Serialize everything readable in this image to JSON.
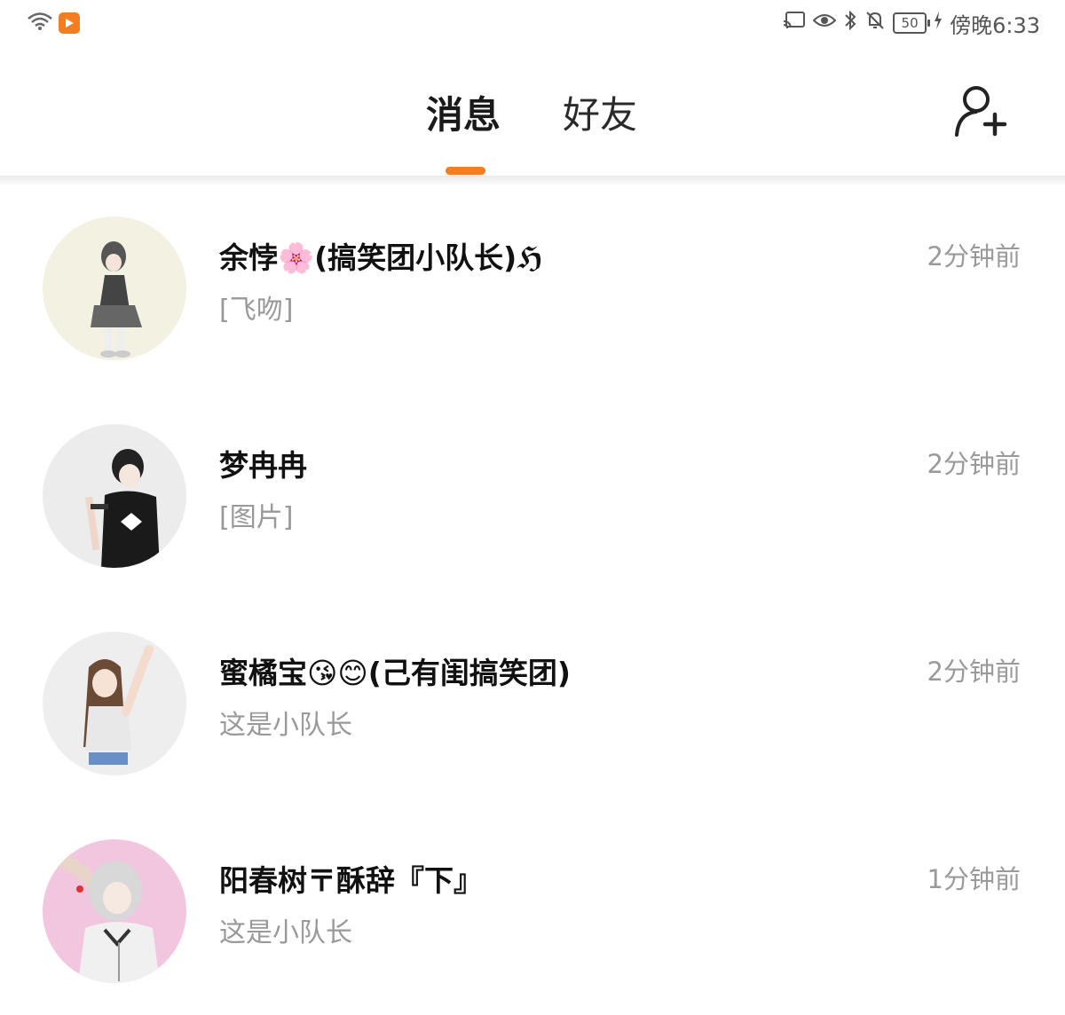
{
  "status_bar": {
    "time": "傍晚6:33",
    "battery": "50",
    "icons": [
      "wifi-icon",
      "app-badge-icon",
      "cast-icon",
      "eye-icon",
      "bluetooth-icon",
      "mute-icon",
      "battery-icon",
      "charging-icon"
    ]
  },
  "header": {
    "tabs": [
      {
        "label": "消息",
        "active": true
      },
      {
        "label": "好友",
        "active": false
      }
    ],
    "add_friend_icon": "add-user-icon",
    "accent_color": "#f57d21"
  },
  "conversations": [
    {
      "name": "余悖🌸(搞笑团小队长)ℌ",
      "preview": "[飞吻]",
      "time": "2分钟前",
      "avatar_bg": "#f3f1e2"
    },
    {
      "name": "梦冉冉",
      "preview": "[图片]",
      "time": "2分钟前",
      "avatar_bg": "#ececec"
    },
    {
      "name": "蜜橘宝😘😊(己有闺搞笑团)",
      "preview": "这是小队长",
      "time": "2分钟前",
      "avatar_bg": "#eeeeee"
    },
    {
      "name": "阳春树〒酥辞『下』",
      "preview": "这是小队长",
      "time": "1分钟前",
      "avatar_bg": "#f2c6df"
    }
  ]
}
